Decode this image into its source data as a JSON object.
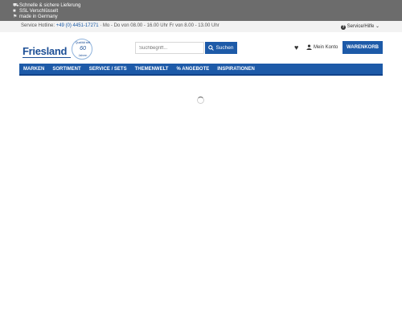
{
  "usp_bar": {
    "items": [
      {
        "icon": "truck-icon",
        "text": "Schnelle & sichere Lieferung"
      },
      {
        "icon": "lock-icon",
        "text": "SSL Verschlüsselt"
      },
      {
        "icon": "flag-icon",
        "text": "made in Germany"
      }
    ]
  },
  "contact_bar": {
    "hotline_label": "Service Hotline:",
    "hotline_number": "+49 (0) 4451-17271",
    "hours": " · Mo - Do von 08.00 - 16.00 Uhr Fr von 8.00 - 13.00 Uhr",
    "service_label": "Service/Hilfe",
    "service_icon": "question-circle-icon",
    "service_chevron": "chevron-down-icon"
  },
  "logo": {
    "wordmark": "Friesland",
    "badge_top": "Qualität seit",
    "badge_number": "60",
    "badge_bottom": "Jahren"
  },
  "search": {
    "placeholder": "Suchbegriff...",
    "button_label": "Suchen"
  },
  "header_actions": {
    "wishlist_icon": "heart-icon",
    "account_label": "Mein Konto",
    "cart_label": "WARENKORB"
  },
  "nav": {
    "items": [
      "MARKEN",
      "SORTIMENT",
      "SERVICE / SETS",
      "THEMENWELT",
      "% ANGEBOTE",
      "INSPIRATIONEN"
    ]
  },
  "colors": {
    "brand_blue": "#1d5aa8",
    "top_bar": "#6c6c6c",
    "contact_bar": "#f2f2f2"
  },
  "loading_indicator": "spinner-icon"
}
